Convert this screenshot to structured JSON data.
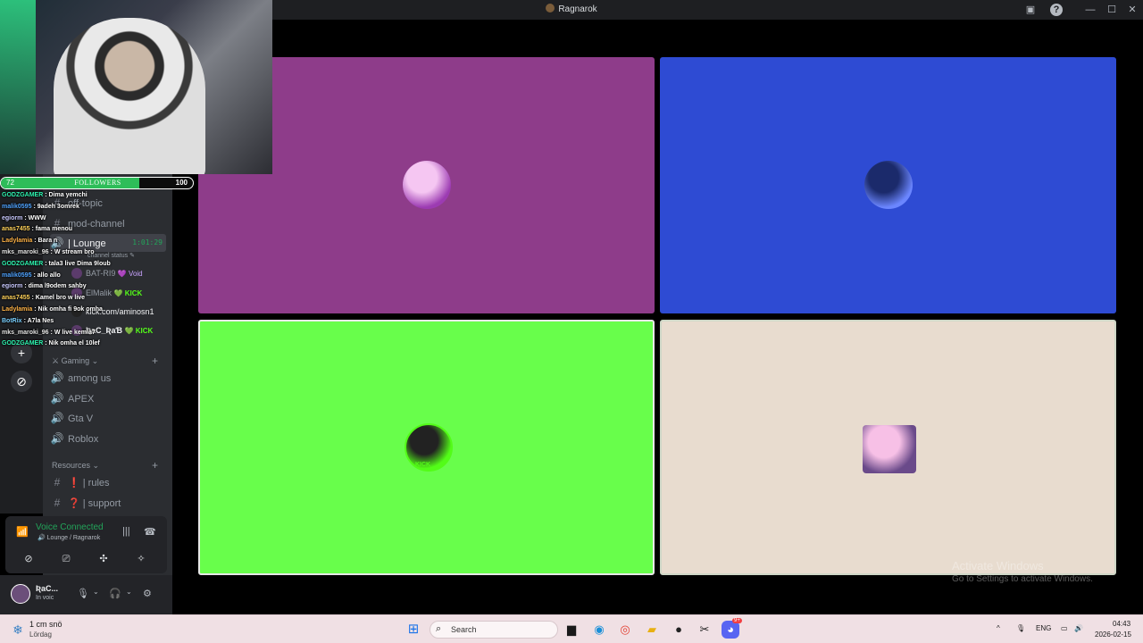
{
  "window": {
    "title": "Ragnarok"
  },
  "tiles": [
    {
      "color": "#8e3c8a",
      "avatar_colors": [
        "#f5c6f2",
        "#9c3bb2"
      ]
    },
    {
      "color": "#2e4bd3",
      "avatar_colors": [
        "#1b2a6b",
        "#6b86ff"
      ]
    },
    {
      "color": "#68fe4b",
      "avatar_colors": [
        "#222",
        "#53fc18"
      ],
      "badge": "KICK"
    },
    {
      "color": "#e8dccf",
      "avatar_colors": [
        "#f7c0e6",
        "#6a4a8a"
      ]
    }
  ],
  "followers": {
    "label": "FOLLOWERS",
    "current": "72",
    "goal": "100",
    "progress": 0.72,
    "color": "#2ebd59"
  },
  "chat": [
    {
      "user": "GODZGAMER",
      "color": "#2ef4b0",
      "text": ": Dima yemchi"
    },
    {
      "user": "malik0595",
      "color": "#4fa3ff",
      "text": ": 9adeh 3omrek"
    },
    {
      "user": "egiorm",
      "color": "#c9c9ff",
      "text": ": WWW"
    },
    {
      "user": "anas7455",
      "color": "#ffd25a",
      "text": ": fama menou"
    },
    {
      "user": "Ladylamia",
      "color": "#ffb347",
      "text": ": Bara n"
    },
    {
      "user": "mks_maroki_96",
      "color": "#e5e5e5",
      "text": ": W stream bro"
    },
    {
      "user": "GODZGAMER",
      "color": "#2ef4b0",
      "text": ": tala3 live Dima 9loub"
    },
    {
      "user": "malik0595",
      "color": "#4fa3ff",
      "text": ": allo allo"
    },
    {
      "user": "egiorm",
      "color": "#c9c9ff",
      "text": ": dima l9odem sahby"
    },
    {
      "user": "anas7455",
      "color": "#ffd25a",
      "text": ": Kamel bro w live"
    },
    {
      "user": "Ladylamia",
      "color": "#ffb347",
      "text": ": Nik omha fi 9ok omha"
    },
    {
      "user": "BotRix",
      "color": "#7ad0ff",
      "text": ": A7la Nes"
    },
    {
      "user": "mks_maroki_96",
      "color": "#e5e5e5",
      "text": ": W live kemla7"
    },
    {
      "user": "GODZGAMER",
      "color": "#2ef4b0",
      "text": ": Nik omha el 10lef"
    }
  ],
  "channels": {
    "top": [
      {
        "sym": "#",
        "label": "off-topic"
      },
      {
        "sym": "#",
        "label": "mod-channel"
      }
    ],
    "lounge": {
      "sym": "🔊",
      "label": "| Lounge",
      "timer": "1:01:29",
      "status": "channel status"
    },
    "voice_users": [
      {
        "name": "BAT-RI9",
        "tag": "💜 Void",
        "tag_type": "void"
      },
      {
        "name": "ElMalik",
        "tag": "💚 KICK",
        "tag_type": "kick"
      },
      {
        "name": "kick.com/aminosn1",
        "tag": "",
        "tag_type": ""
      },
      {
        "name": "ƦaC_ƦaƁ",
        "tag": "💚 KICK",
        "tag_type": "kick"
      }
    ],
    "gaming_category": "Gaming",
    "gaming": [
      {
        "sym": "🔊",
        "label": "among us"
      },
      {
        "sym": "🔊",
        "label": "APEX"
      },
      {
        "sym": "🔊",
        "label": "Gta V"
      },
      {
        "sym": "🔊",
        "label": "Roblox"
      }
    ],
    "resources_category": "Resources",
    "resources": [
      {
        "sym": "#",
        "label": "❗ | rules"
      },
      {
        "sym": "#",
        "label": "❓ | support"
      }
    ]
  },
  "rail": {
    "add_icon": "+",
    "discover_icon": "⊘"
  },
  "voice_panel": {
    "title": "Voice Connected",
    "subtitle": "🔊 Lounge / Ragnarok",
    "buttons": [
      "camera-off-icon",
      "screen-share-icon",
      "activities-icon",
      "soundboard-icon"
    ]
  },
  "user": {
    "name": "ƦaC...",
    "status": "In voic"
  },
  "activate": {
    "line1": "Activate Windows",
    "line2": "Go to Settings to activate Windows."
  },
  "taskbar": {
    "weather_temp": "1 cm snö",
    "weather_day": "Lördag",
    "search_placeholder": "Search",
    "lang": "ENG",
    "time": "04:43",
    "date": "2026-02-15",
    "discord_badge": "9+"
  }
}
